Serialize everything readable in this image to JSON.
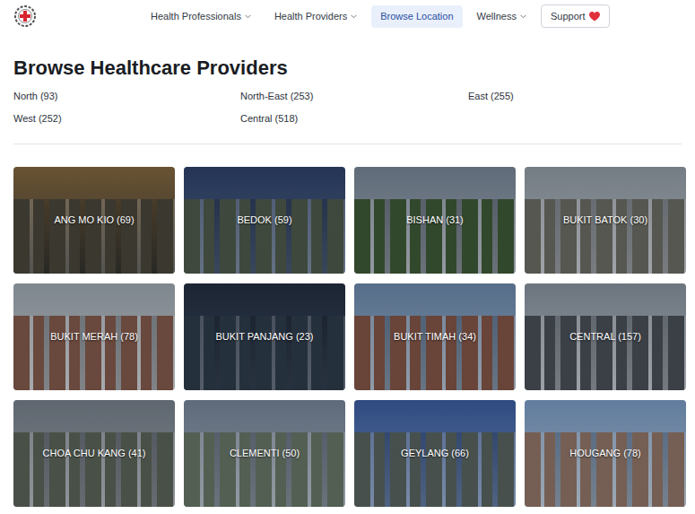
{
  "nav": {
    "items": [
      {
        "label": "Health Professionals",
        "kind": "dropdown",
        "selected": false
      },
      {
        "label": "Health Providers",
        "kind": "dropdown",
        "selected": false
      },
      {
        "label": "Browse Location",
        "kind": "link",
        "selected": true
      },
      {
        "label": "Wellness",
        "kind": "dropdown",
        "selected": false
      },
      {
        "label": "Support",
        "kind": "button",
        "selected": false
      }
    ]
  },
  "title": "Browse Healthcare Providers",
  "regions": [
    "North (93)",
    "North-East (253)",
    "East (255)",
    "West (252)",
    "Central (518)"
  ],
  "locations": [
    "ANG MO KIO (69)",
    "BEDOK (59)",
    "BISHAN (31)",
    "BUKIT BATOK (30)",
    "BUKIT MERAH (78)",
    "BUKIT PANJANG (23)",
    "BUKIT TIMAH (34)",
    "CENTRAL (157)",
    "CHOA CHU KANG (41)",
    "CLEMENTI (50)",
    "GEYLANG (66)",
    "HOUGANG (78)"
  ]
}
